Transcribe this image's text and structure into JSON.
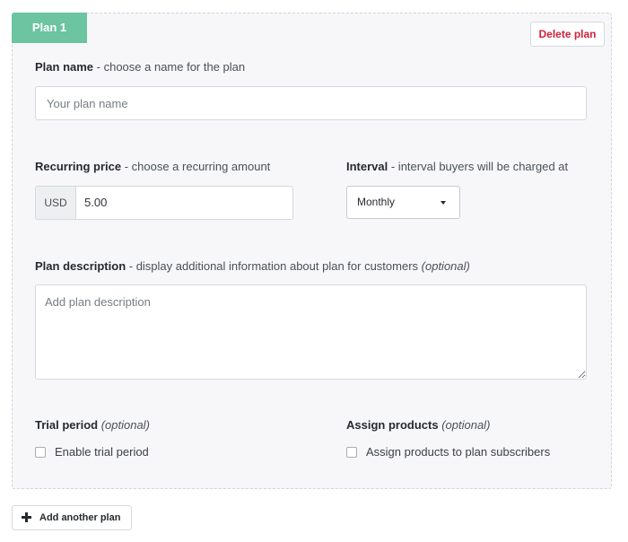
{
  "plan": {
    "tab_label": "Plan 1",
    "delete_label": "Delete plan",
    "name": {
      "label": "Plan name",
      "hint": " - choose a name for the plan",
      "placeholder": "Your plan name"
    },
    "price": {
      "label": "Recurring price",
      "hint": " - choose a recurring amount",
      "currency": "USD",
      "value": "5.00"
    },
    "interval": {
      "label": "Interval",
      "hint": " - interval buyers will be charged at",
      "selected": "Monthly"
    },
    "description": {
      "label": "Plan description",
      "hint": " - display additional information about plan for customers ",
      "optional": "(optional)",
      "placeholder": "Add plan description"
    },
    "trial": {
      "label": "Trial period",
      "optional": "(optional)",
      "checkbox_label": "Enable trial period"
    },
    "products": {
      "label": "Assign products",
      "optional": "(optional)",
      "checkbox_label": "Assign products to plan subscribers"
    }
  },
  "add_plan_label": "Add another plan",
  "colors": {
    "accent": "#6cc4a1",
    "danger": "#d0233a",
    "card_bg": "#f7f7f9"
  }
}
